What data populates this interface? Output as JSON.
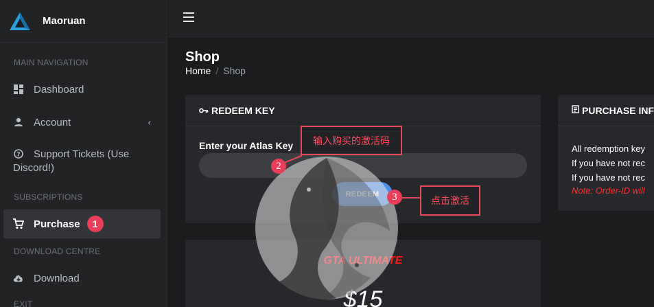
{
  "brand": {
    "name": "Maoruan"
  },
  "sidebar": {
    "headers": [
      "MAIN NAVIGATION",
      "SUBSCRIPTIONS",
      "DOWNLOAD CENTRE",
      "EXIT"
    ],
    "items": [
      {
        "label": "Dashboard",
        "icon": "dashboard-icon"
      },
      {
        "label": "Account",
        "icon": "user-icon"
      },
      {
        "label": "Support Tickets (Use",
        "label2": "Discord!)",
        "icon": "question-circle-icon"
      },
      {
        "label": "Purchase",
        "icon": "cart-icon",
        "badge": "1"
      },
      {
        "label": "Download",
        "icon": "cloud-download-icon"
      }
    ]
  },
  "page": {
    "title": "Shop"
  },
  "breadcrumb": {
    "home": "Home",
    "sep": "/",
    "current": "Shop"
  },
  "redeem": {
    "title": "REDEEM KEY",
    "field_label": "Enter your Atlas Key",
    "input_value": "",
    "button_label": "REDEEM"
  },
  "purchase_info": {
    "title": "PURCHASE INFO",
    "lines": [
      "All redemption key",
      "If you have not rec",
      "If you have not rec"
    ],
    "note": "Note: Order-ID will"
  },
  "product": {
    "name": "GTA ULTIMATE",
    "price": "$15"
  },
  "annotations": {
    "input_hint": "输入购买的激活码",
    "button_hint": "点击激活",
    "step2": "2",
    "step3": "3"
  },
  "colors": {
    "accent": "#4d8ee6",
    "badge": "#e83e5a",
    "note": "#ff2d2d",
    "annotation": "#e8485a"
  }
}
